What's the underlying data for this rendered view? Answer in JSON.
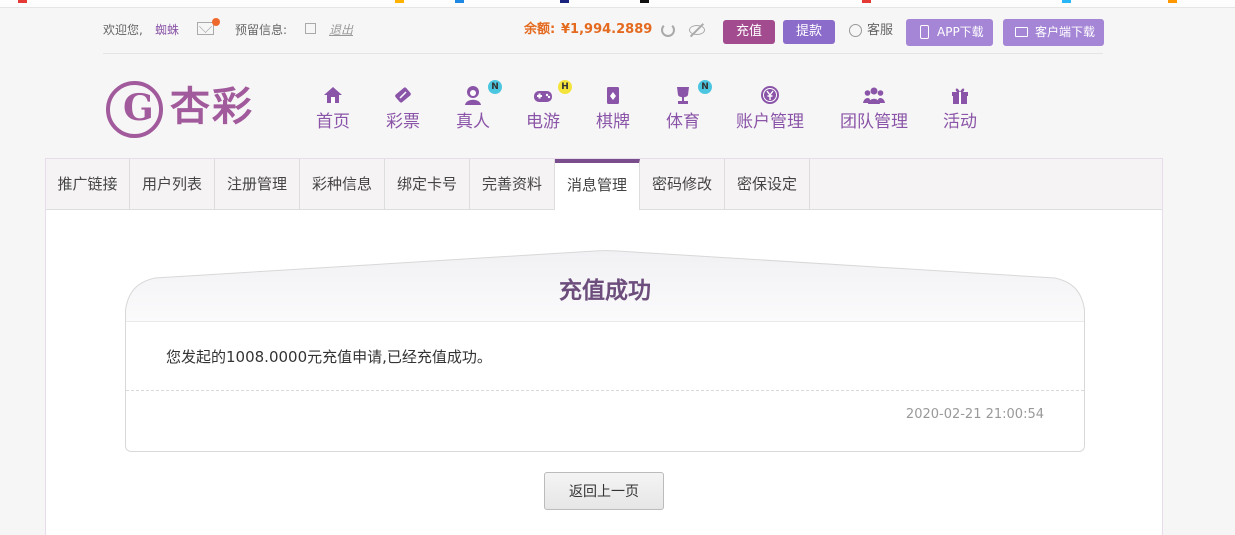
{
  "topbar": {
    "welcome": "欢迎您,",
    "username": "蜘蛛",
    "reserved_info_label": "预留信息:",
    "logout": "退出",
    "balance_label": "余额:",
    "balance_value": "¥1,994.2889",
    "recharge": "充值",
    "withdraw": "提款",
    "customer_service": "客服",
    "app_download": "APP下载",
    "client_download": "客户端下载"
  },
  "logo": {
    "text": "杏彩"
  },
  "nav": {
    "items": [
      {
        "label": "首页",
        "icon": "home-icon"
      },
      {
        "label": "彩票",
        "icon": "ticket-icon"
      },
      {
        "label": "真人",
        "icon": "dealer-icon",
        "badge": "N"
      },
      {
        "label": "电游",
        "icon": "gamepad-icon",
        "badge": "H"
      },
      {
        "label": "棋牌",
        "icon": "cards-icon"
      },
      {
        "label": "体育",
        "icon": "trophy-icon",
        "badge": "N"
      },
      {
        "label": "账户管理",
        "icon": "yen-coin-icon"
      },
      {
        "label": "团队管理",
        "icon": "team-icon"
      },
      {
        "label": "活动",
        "icon": "gift-icon"
      }
    ]
  },
  "tabs": [
    "推广链接",
    "用户列表",
    "注册管理",
    "彩种信息",
    "绑定卡号",
    "完善资料",
    "消息管理",
    "密码修改",
    "密保设定"
  ],
  "active_tab": "消息管理",
  "message": {
    "title": "充值成功",
    "text": "您发起的1008.0000元充值申请,已经充值成功。",
    "timestamp": "2020-02-21 21:00:54"
  },
  "back_button": "返回上一页",
  "colors": {
    "brand_purple": "#8a55a8",
    "recharge_button": "#a24c8f",
    "withdraw_button": "#8c6ccb",
    "balance_orange": "#e46a1f",
    "title_purple": "#6d4d7c"
  }
}
